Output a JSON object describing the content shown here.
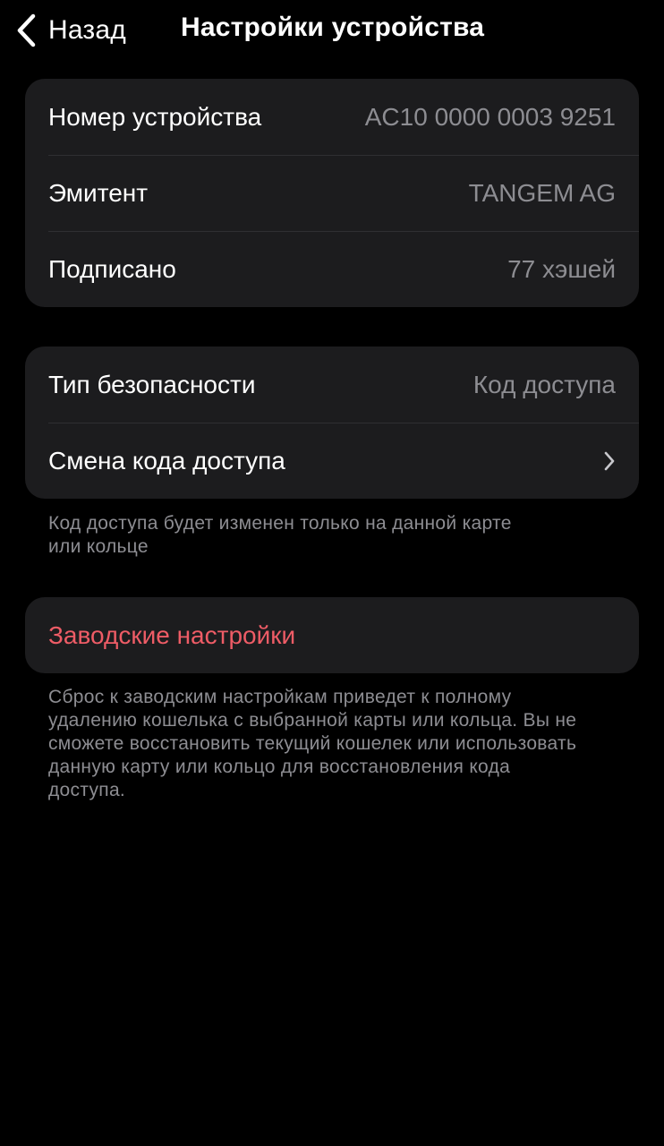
{
  "nav": {
    "back_label": "Назад",
    "title": "Настройки устройства"
  },
  "device_info": [
    {
      "label": "Номер устройства",
      "value": "AC10 0000 0003 9251"
    },
    {
      "label": "Эмитент",
      "value": "TANGEM AG"
    },
    {
      "label": "Подписано",
      "value": "77 хэшей"
    }
  ],
  "security": {
    "type_label": "Тип безопасности",
    "type_value": "Код доступа",
    "change_label": "Смена кода доступа",
    "footnote_lines": [
      "Код доступа будет изменен только на данной карте",
      "или кольце"
    ]
  },
  "reset": {
    "label": "Заводские настройки",
    "footnote_lines": [
      "Сброс к заводским настройкам приведет к полному",
      "удалению кошелька с выбранной карты или кольца. Вы не",
      "сможете восстановить текущий кошелек или использовать",
      "данную карту или кольцо для восстановления кода",
      "доступа."
    ]
  },
  "icons": {
    "back": "chevron-left-icon",
    "disclosure": "chevron-right-icon"
  },
  "colors": {
    "background": "#000000",
    "cell": "#1c1c1e",
    "secondary_text": "#8d8d92",
    "danger": "#ee5c66"
  }
}
